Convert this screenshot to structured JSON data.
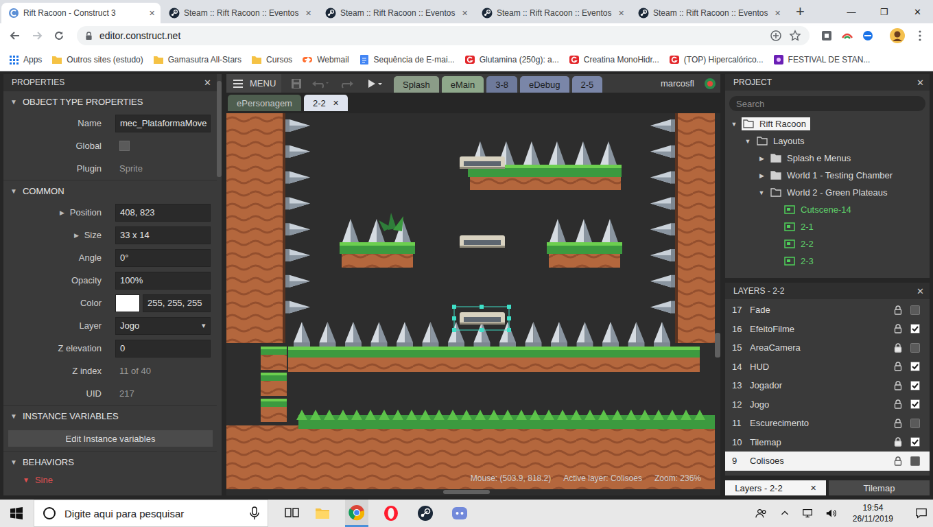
{
  "browser": {
    "tabs": [
      {
        "label": "Rift Racoon - Construct 3",
        "selected": true,
        "close": "✕",
        "kind": "construct"
      },
      {
        "label": "Steam :: Rift Racoon :: Eventos",
        "selected": false,
        "close": "✕",
        "kind": "steam"
      },
      {
        "label": "Steam :: Rift Racoon :: Eventos",
        "selected": false,
        "close": "✕",
        "kind": "steam"
      },
      {
        "label": "Steam :: Rift Racoon :: Eventos",
        "selected": false,
        "close": "✕",
        "kind": "steam"
      },
      {
        "label": "Steam :: Rift Racoon :: Eventos",
        "selected": false,
        "close": "✕",
        "kind": "steam"
      }
    ],
    "new_tab": "+",
    "window_controls": [
      "—",
      "❐",
      "✕"
    ],
    "address": "editor.construct.net",
    "bookmarks": [
      {
        "label": "Apps",
        "kind": "apps"
      },
      {
        "label": "Outros sites (estudo)",
        "kind": "folder"
      },
      {
        "label": "Gamasutra All-Stars",
        "kind": "folder"
      },
      {
        "label": "Cursos",
        "kind": "folder"
      },
      {
        "label": "Webmail",
        "kind": "cpanel"
      },
      {
        "label": "Sequência de E-mai...",
        "kind": "doc"
      },
      {
        "label": "Glutamina (250g): a...",
        "kind": "store"
      },
      {
        "label": "Creatina MonoHidr...",
        "kind": "store"
      },
      {
        "label": "(TOP) Hipercalórico...",
        "kind": "store"
      },
      {
        "label": "FESTIVAL DE STAN...",
        "kind": "festival"
      }
    ]
  },
  "properties": {
    "title": "PROPERTIES",
    "close": "✕",
    "sections": [
      {
        "title": "OBJECT TYPE PROPERTIES",
        "toggle": "▼",
        "expanded": true,
        "rows": [
          {
            "label": "Name",
            "kind": "field",
            "value": "mec_PlataformaMove"
          },
          {
            "label": "Global",
            "kind": "checkbox",
            "checked": false
          },
          {
            "label": "Plugin",
            "kind": "readonly",
            "value": "Sprite"
          }
        ]
      },
      {
        "title": "COMMON",
        "toggle": "▼",
        "expanded": true,
        "rows": [
          {
            "label": "Position",
            "kind": "field",
            "value": "408, 823",
            "expander": "▶"
          },
          {
            "label": "Size",
            "kind": "field",
            "value": "33 x 14",
            "expander": "▶"
          },
          {
            "label": "Angle",
            "kind": "field",
            "value": "0°"
          },
          {
            "label": "Opacity",
            "kind": "field",
            "value": "100%"
          },
          {
            "label": "Color",
            "kind": "color",
            "value": "255, 255, 255",
            "color": "#ffffff"
          },
          {
            "label": "Layer",
            "kind": "dropdown",
            "value": "Jogo",
            "arrow": "▾"
          },
          {
            "label": "Z elevation",
            "kind": "field",
            "value": "0"
          },
          {
            "label": "Z index",
            "kind": "readonly",
            "value": "11 of 40"
          },
          {
            "label": "UID",
            "kind": "readonly",
            "value": "217"
          }
        ]
      },
      {
        "title": "INSTANCE VARIABLES",
        "toggle": "▼",
        "expanded": true,
        "rows": [
          {
            "label": "Edit Instance variables",
            "kind": "button"
          }
        ]
      },
      {
        "title": "BEHAVIORS",
        "toggle": "▼",
        "expanded": true,
        "rows": [
          {
            "label": "Sine",
            "kind": "behavior",
            "toggle": "▼"
          }
        ]
      }
    ]
  },
  "editor": {
    "menu": "MENU",
    "user": "marcosfl",
    "tabs": [
      {
        "label": "Splash",
        "row": 1,
        "selected": false,
        "color": "#8b9c88"
      },
      {
        "label": "eMain",
        "row": 1,
        "selected": false,
        "color": "#8ea88b"
      },
      {
        "label": "3-8",
        "row": 1,
        "selected": false,
        "color": "#6e7a9b"
      },
      {
        "label": "eDebug",
        "row": 1,
        "selected": false,
        "color": "#7a86a8"
      },
      {
        "label": "2-5",
        "row": 1,
        "selected": false,
        "color": "#7a86a8"
      },
      {
        "label": "ePersonagem",
        "row": 2,
        "selected": false,
        "color": "#4e5e4f"
      },
      {
        "label": "2-2",
        "row": 2,
        "selected": true,
        "color": "#dfe4ef",
        "close": "✕"
      }
    ],
    "scene": {
      "moving_platforms": [
        {
          "selected": false
        },
        {
          "selected": false
        },
        {
          "selected": true
        }
      ]
    },
    "status": {
      "mouse": "Mouse: (503.9, 818.2)",
      "active_layer": "Active layer: Colisoes",
      "zoom": "Zoom: 236%"
    }
  },
  "project": {
    "title": "PROJECT",
    "close": "✕",
    "search_placeholder": "Search",
    "tree": [
      {
        "label": "Rift Racoon",
        "depth": 0,
        "kind": "folder",
        "toggle": "▼",
        "expanded": true,
        "selected": true
      },
      {
        "label": "Layouts",
        "depth": 1,
        "kind": "folder",
        "toggle": "▼",
        "expanded": true,
        "selected": false
      },
      {
        "label": "Splash e Menus",
        "depth": 2,
        "kind": "folder",
        "toggle": "▶",
        "expanded": false,
        "selected": false
      },
      {
        "label": "World 1 - Testing Chamber",
        "depth": 2,
        "kind": "folder",
        "toggle": "▶",
        "expanded": false,
        "selected": false
      },
      {
        "label": "World 2 - Green Plateaus",
        "depth": 2,
        "kind": "folder",
        "toggle": "▼",
        "expanded": true,
        "selected": false
      },
      {
        "label": "Cutscene-14",
        "depth": 3,
        "kind": "layout",
        "selected": false
      },
      {
        "label": "2-1",
        "depth": 3,
        "kind": "layout",
        "selected": false
      },
      {
        "label": "2-2",
        "depth": 3,
        "kind": "layout",
        "selected": false
      },
      {
        "label": "2-3",
        "depth": 3,
        "kind": "layout",
        "selected": false
      }
    ]
  },
  "layers": {
    "title": "LAYERS - 2-2",
    "close": "✕",
    "items": [
      {
        "index": "17",
        "name": "Fade",
        "locked": false,
        "visible": false,
        "selected": false
      },
      {
        "index": "16",
        "name": "EfeitoFilme",
        "locked": false,
        "visible": true,
        "selected": false
      },
      {
        "index": "15",
        "name": "AreaCamera",
        "locked": true,
        "visible": false,
        "selected": false
      },
      {
        "index": "14",
        "name": "HUD",
        "locked": false,
        "visible": true,
        "selected": false
      },
      {
        "index": "13",
        "name": "Jogador",
        "locked": false,
        "visible": true,
        "selected": false
      },
      {
        "index": "12",
        "name": "Jogo",
        "locked": false,
        "visible": true,
        "selected": false
      },
      {
        "index": "11",
        "name": "Escurecimento",
        "locked": false,
        "visible": false,
        "selected": false
      },
      {
        "index": "10",
        "name": "Tilemap",
        "locked": true,
        "visible": true,
        "selected": false
      },
      {
        "index": "9",
        "name": "Colisoes",
        "locked": false,
        "visible": false,
        "selected": true
      }
    ]
  },
  "bottom_tabs": [
    {
      "label": "Layers - 2-2",
      "selected": true,
      "close": "✕"
    },
    {
      "label": "Tilemap",
      "selected": false
    }
  ],
  "taskbar": {
    "search_placeholder": "Digite aqui para pesquisar",
    "apps": [
      {
        "kind": "explorer",
        "active": false
      },
      {
        "kind": "chrome",
        "active": true
      },
      {
        "kind": "opera",
        "active": false
      },
      {
        "kind": "steam",
        "active": false
      },
      {
        "kind": "discord",
        "active": false
      }
    ],
    "time": "19:54",
    "date": "26/11/2019"
  }
}
